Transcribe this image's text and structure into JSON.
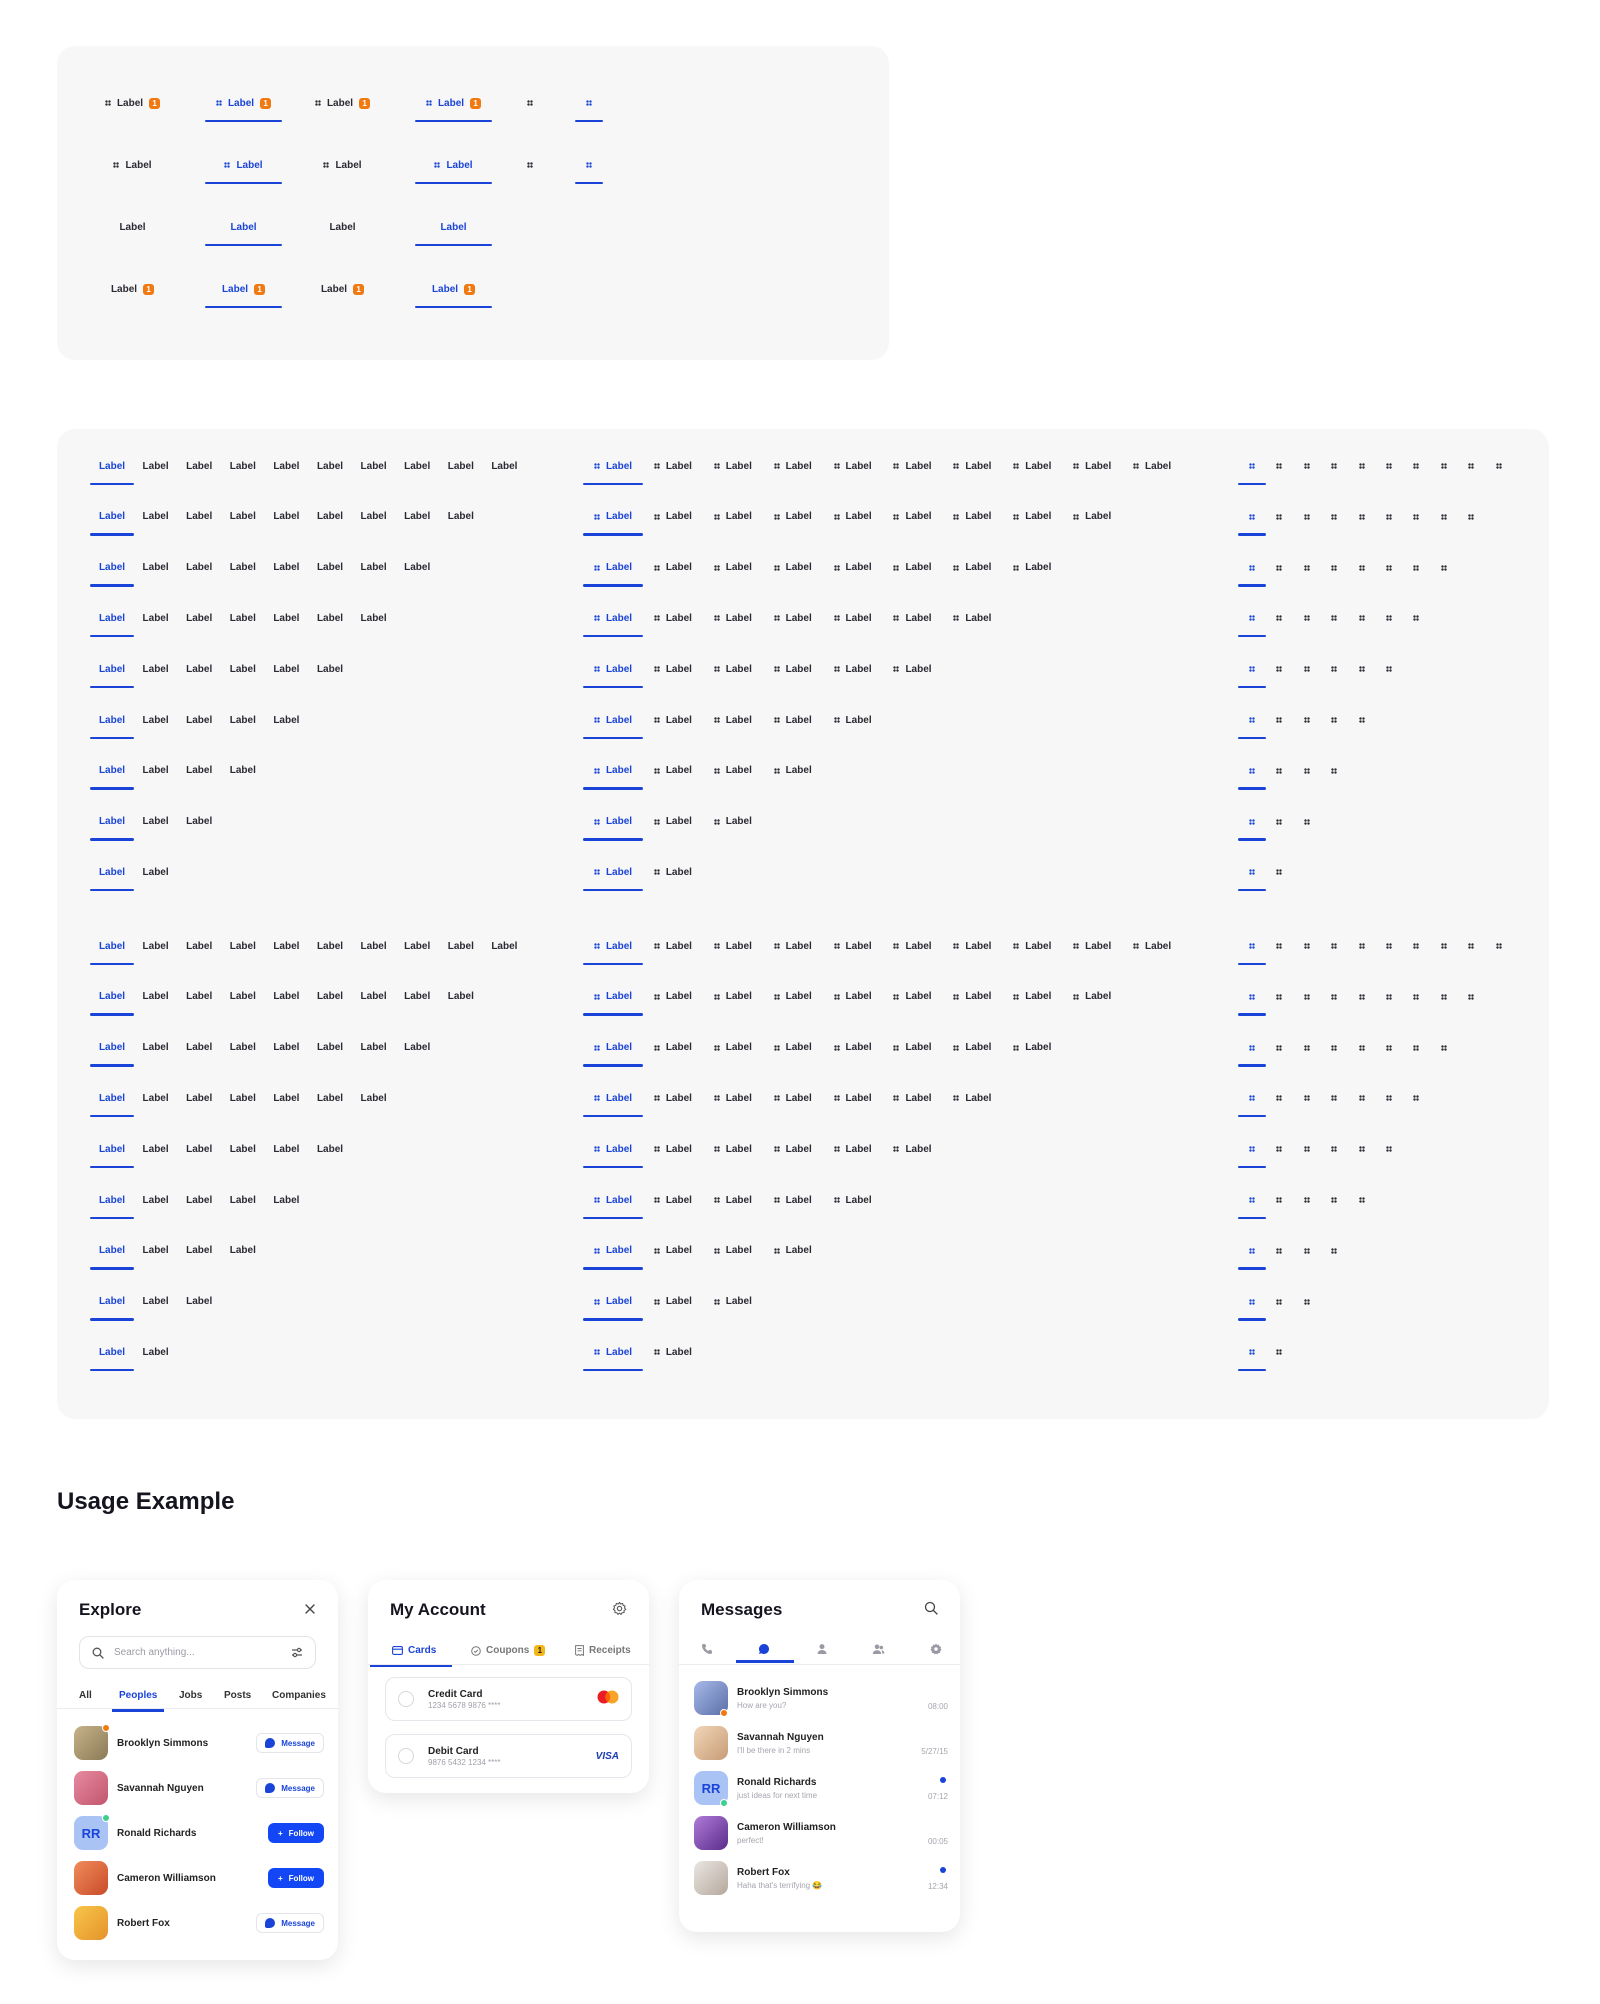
{
  "tab_label": "Label",
  "badge_count": "1",
  "colors": {
    "accent": "#1a44d8",
    "badge": "#f07a12",
    "panel": "#f7f7f7"
  },
  "usage": {
    "title": "Usage Example",
    "explore": {
      "title": "Explore",
      "search_placeholder": "Search anything...",
      "tabs": [
        "All",
        "Peoples",
        "Jobs",
        "Posts",
        "Companies"
      ],
      "active_tab": "Peoples",
      "people": [
        {
          "name": "Brooklyn Simmons",
          "action": "Message"
        },
        {
          "name": "Savannah Nguyen",
          "action": "Message"
        },
        {
          "name": "Ronald Richards",
          "initials": "RR",
          "action": "Follow"
        },
        {
          "name": "Cameron Williamson",
          "action": "Follow"
        },
        {
          "name": "Robert Fox",
          "action": "Message"
        }
      ]
    },
    "account": {
      "title": "My Account",
      "tabs": [
        {
          "label": "Cards",
          "icon": "card-icon"
        },
        {
          "label": "Coupons",
          "icon": "coupon-icon",
          "badge": "1"
        },
        {
          "label": "Receipts",
          "icon": "receipt-icon"
        }
      ],
      "active_tab": "Cards",
      "payments": [
        {
          "name": "Credit Card",
          "number": "1234 5678 9876 ****",
          "brand": "mastercard"
        },
        {
          "name": "Debit Card",
          "number": "9876 5432 1234 ****",
          "brand": "VISA"
        }
      ]
    },
    "messages": {
      "title": "Messages",
      "tabs": [
        "phone-icon",
        "chat-icon",
        "user-icon",
        "group-icon",
        "settings-icon"
      ],
      "active_tab": "chat-icon",
      "threads": [
        {
          "name": "Brooklyn Simmons",
          "preview": "How are you?",
          "time": "08:00",
          "unread": false
        },
        {
          "name": "Savannah Nguyen",
          "preview": "I'll be there in 2 mins",
          "time": "5/27/15",
          "unread": false
        },
        {
          "name": "Ronald Richards",
          "initials": "RR",
          "preview": "just ideas for next time",
          "time": "07:12",
          "unread": true
        },
        {
          "name": "Cameron Williamson",
          "preview": "perfect!",
          "time": "00:05",
          "unread": false
        },
        {
          "name": "Robert Fox",
          "preview": "Haha that's terrifying 😂",
          "time": "12:34",
          "unread": true
        }
      ]
    }
  }
}
